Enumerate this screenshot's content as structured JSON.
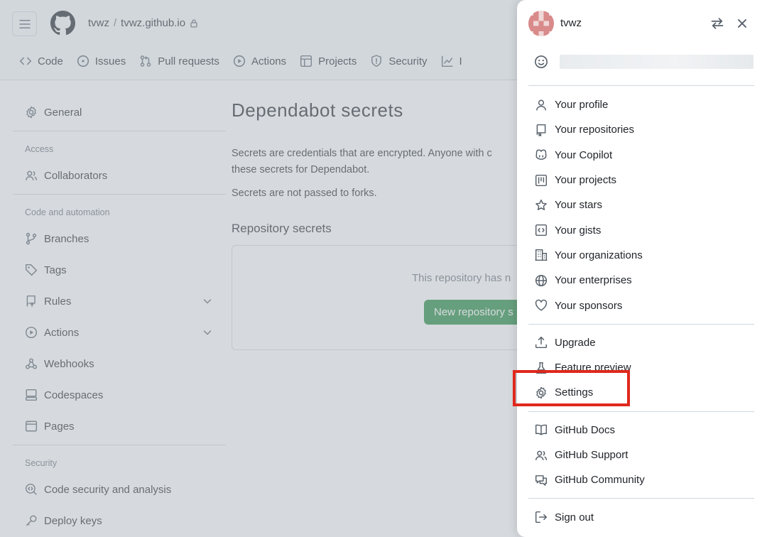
{
  "header": {
    "owner": "tvwz",
    "separator": "/",
    "repo": "tvwz.github.io"
  },
  "repo_tabs": [
    {
      "label": "Code",
      "icon": "code-icon"
    },
    {
      "label": "Issues",
      "icon": "issue-icon"
    },
    {
      "label": "Pull requests",
      "icon": "pull-request-icon"
    },
    {
      "label": "Actions",
      "icon": "play-icon"
    },
    {
      "label": "Projects",
      "icon": "table-icon"
    },
    {
      "label": "Security",
      "icon": "shield-icon"
    },
    {
      "label": "I",
      "icon": "graph-icon"
    }
  ],
  "sidebar": {
    "general": "General",
    "access_heading": "Access",
    "collaborators": "Collaborators",
    "code_heading": "Code and automation",
    "branches": "Branches",
    "tags": "Tags",
    "rules": "Rules",
    "actions": "Actions",
    "webhooks": "Webhooks",
    "codespaces": "Codespaces",
    "pages": "Pages",
    "security_heading": "Security",
    "code_security": "Code security and analysis",
    "deploy_keys": "Deploy keys"
  },
  "main": {
    "title": "Dependabot secrets",
    "description_line1": "Secrets are credentials that are encrypted. Anyone with c",
    "description_line2": "these secrets for Dependabot.",
    "forks_note": "Secrets are not passed to forks.",
    "repo_secrets_heading": "Repository secrets",
    "empty_message": "This repository has n",
    "new_secret_button": "New repository s"
  },
  "drawer": {
    "username": "tvwz",
    "groups": [
      [
        {
          "label": "Your profile",
          "icon": "person-icon"
        },
        {
          "label": "Your repositories",
          "icon": "repo-icon"
        },
        {
          "label": "Your Copilot",
          "icon": "copilot-icon"
        },
        {
          "label": "Your projects",
          "icon": "project-icon"
        },
        {
          "label": "Your stars",
          "icon": "star-icon"
        },
        {
          "label": "Your gists",
          "icon": "gist-icon"
        },
        {
          "label": "Your organizations",
          "icon": "organization-icon"
        },
        {
          "label": "Your enterprises",
          "icon": "globe-icon"
        },
        {
          "label": "Your sponsors",
          "icon": "heart-icon"
        }
      ],
      [
        {
          "label": "Upgrade",
          "icon": "upload-icon"
        },
        {
          "label": "Feature preview",
          "icon": "beaker-icon"
        },
        {
          "label": "Settings",
          "icon": "gear-icon"
        }
      ],
      [
        {
          "label": "GitHub Docs",
          "icon": "book-icon"
        },
        {
          "label": "GitHub Support",
          "icon": "people-icon"
        },
        {
          "label": "GitHub Community",
          "icon": "comment-discussion-icon"
        }
      ],
      [
        {
          "label": "Sign out",
          "icon": "sign-out-icon"
        }
      ]
    ]
  },
  "colors": {
    "accent_green": "#1f883d",
    "highlight_red": "#e0281c"
  }
}
